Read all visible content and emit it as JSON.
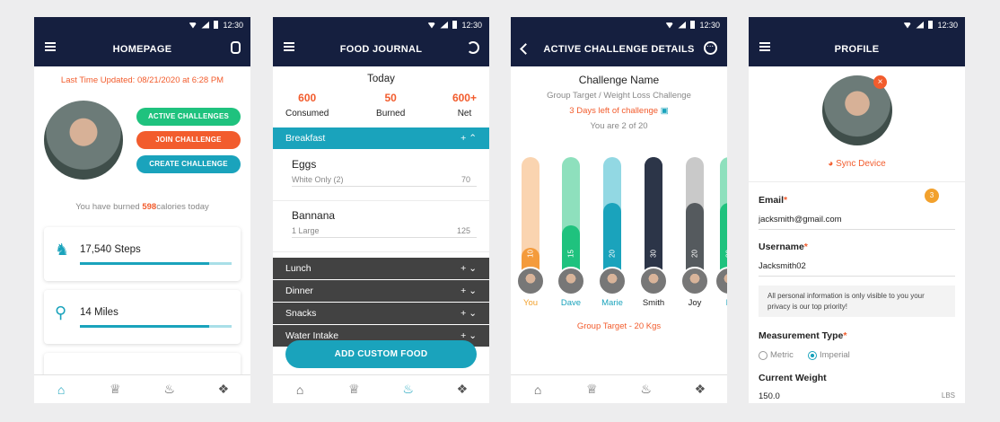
{
  "status": {
    "time": "12:30"
  },
  "home": {
    "title": "HOMEPAGE",
    "last_updated": "Last Time Updated: 08/21/2020 at 6:28 PM",
    "buttons": {
      "active": "ACTIVE CHALLENGES",
      "join": "JOIN CHALLENGE",
      "create": "CREATE CHALLENGE"
    },
    "burned_prefix": "You have burned",
    "burned_value": "598",
    "burned_suffix": "calories today",
    "cards": [
      {
        "label": "17,540 Steps",
        "icon": "footsteps-icon",
        "progress": 0.85
      },
      {
        "label": "14 Miles",
        "icon": "location-pin-icon",
        "progress": 0.85
      }
    ]
  },
  "food": {
    "title": "FOOD JOURNAL",
    "today": "Today",
    "stats": [
      {
        "value": "600",
        "label": "Consumed"
      },
      {
        "value": "50",
        "label": "Burned"
      },
      {
        "value": "600+",
        "label": "Net"
      }
    ],
    "breakfast": "Breakfast",
    "items": [
      {
        "name": "Eggs",
        "desc": "White Only (2)",
        "cal": "70"
      },
      {
        "name": "Bannana",
        "desc": "1 Large",
        "cal": "125"
      }
    ],
    "meals": [
      "Lunch",
      "Dinner",
      "Snacks",
      "Water Intake"
    ],
    "add_button": "ADD CUSTOM FOOD"
  },
  "challenge": {
    "title": "ACTIVE CHALLENGE DETAILS",
    "name": "Challenge Name",
    "subtitle": "Group Target / Weight Loss Challenge",
    "days_left": "3 Days left of challenge",
    "position": "You are 2 of 20",
    "group_target": "Group Target - 20 Kgs",
    "chart_data": {
      "type": "bar",
      "categories": [
        "You",
        "Dave",
        "Marie",
        "Smith",
        "Joy",
        "D"
      ],
      "values": [
        10,
        15,
        20,
        30,
        20,
        20
      ],
      "ylim": [
        0,
        30
      ],
      "colors": [
        "#f49b3c",
        "#1fc27e",
        "#1aa3bc",
        "#2c3548",
        "#555a5e",
        "#1fc27e"
      ],
      "track_colors": [
        "#fad4b0",
        "#8ee0bd",
        "#92d8e3",
        "#2c3548",
        "#c9c9c9",
        "#8ee0bd"
      ]
    }
  },
  "profile": {
    "title": "PROFILE",
    "sync": "Sync Device",
    "badge": "3",
    "email_label": "Email",
    "email": "jacksmith@gmail.com",
    "username_label": "Username",
    "username": "Jacksmith02",
    "note": "All personal information is only visible to you your privacy is our top priority!",
    "measurement_label": "Measurement Type",
    "metric": "Metric",
    "imperial": "Imperial",
    "weight_label": "Current Weight",
    "weight": "150.0",
    "unit": "LBS",
    "required_mark": "*"
  }
}
